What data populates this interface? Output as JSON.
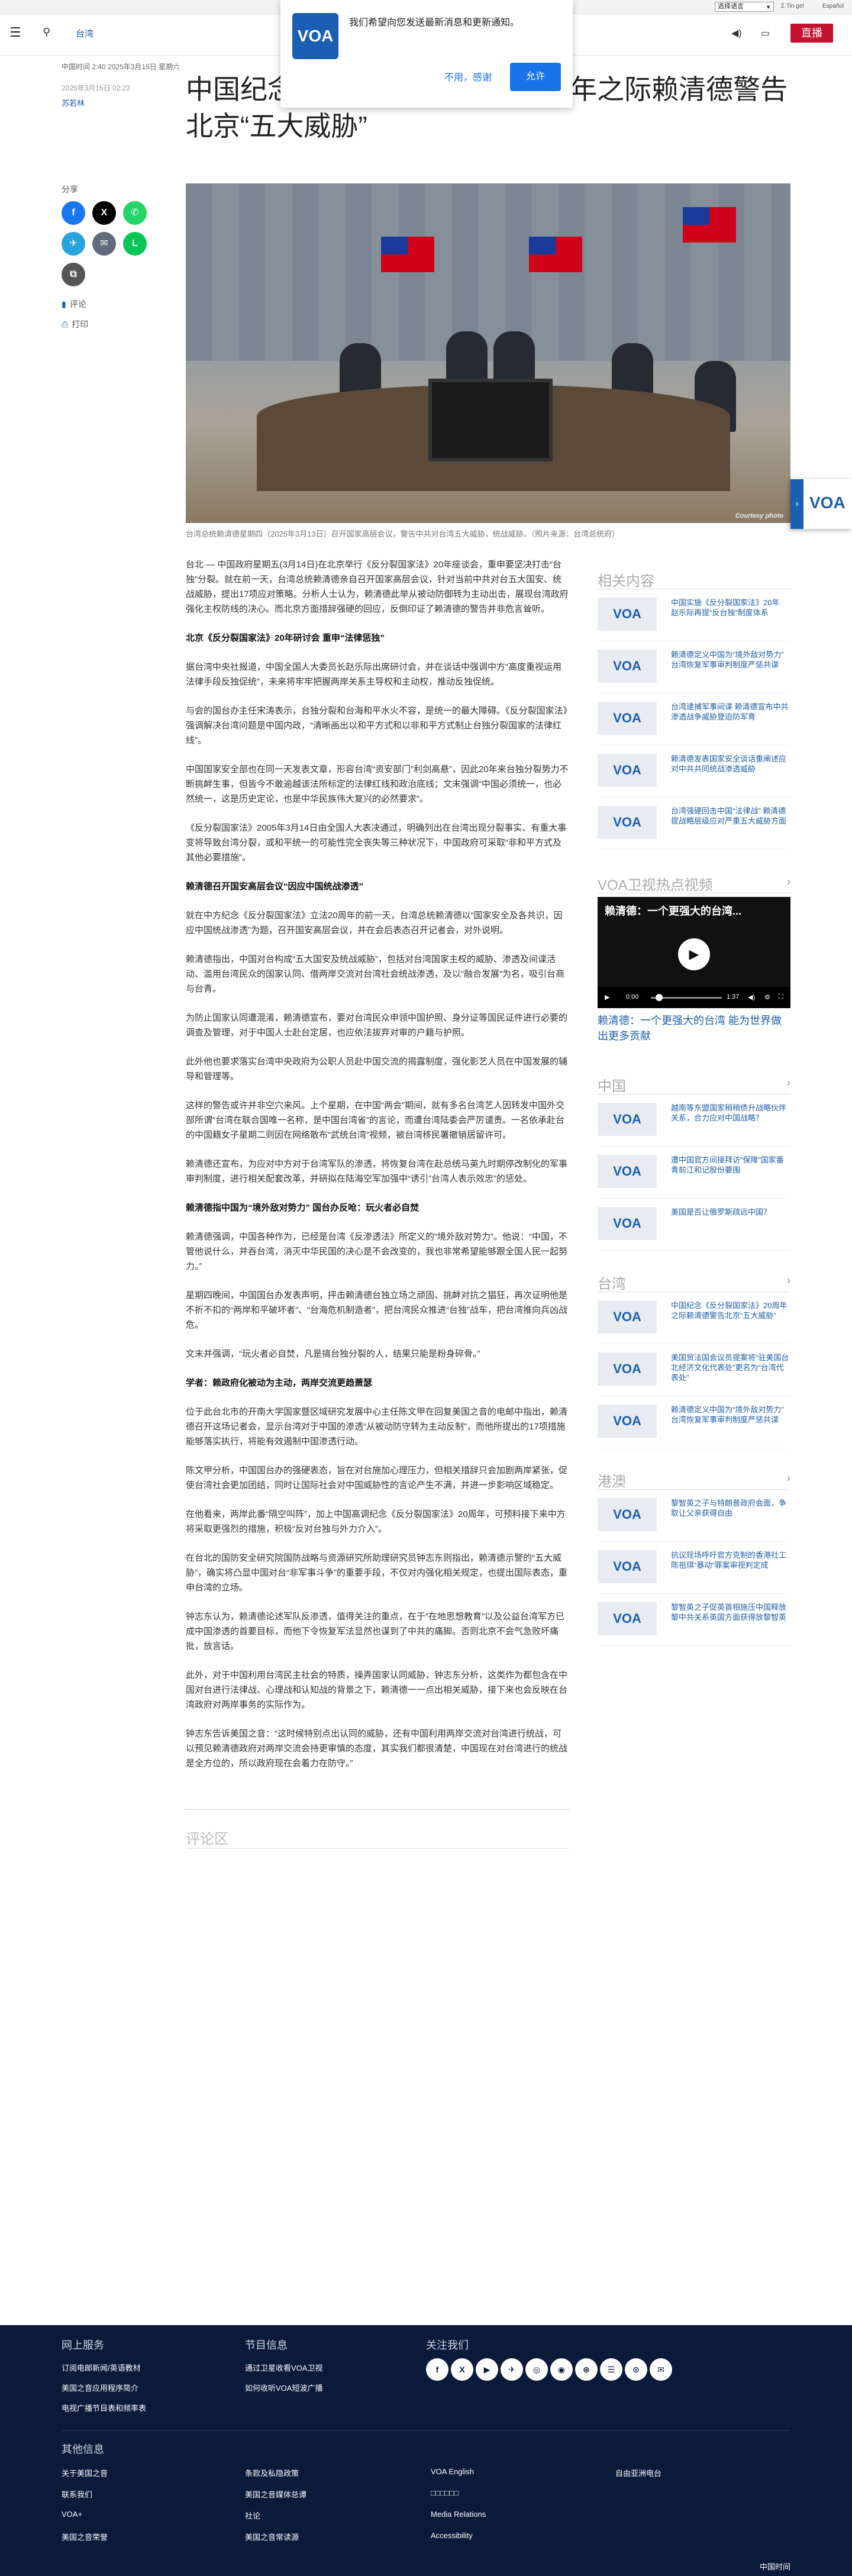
{
  "topbar": {
    "language": "选择语言",
    "links": [
      "Σ Tin gel",
      "Español"
    ]
  },
  "header": {
    "section": "台湾",
    "live_label": "直播"
  },
  "notification": {
    "logo": "VOA",
    "message": "我们希望向您发送最新消息和更新通知。",
    "decline": "不用，感谢",
    "allow": "允许"
  },
  "meta": {
    "time": "中国时间 2:40 2025年3月15日 星期六",
    "date": "2025年3月15日 02:22",
    "author": "苏若林"
  },
  "article": {
    "title": "中国纪念《反分裂国家法》20周年之际赖清德警告北京“五大威胁”",
    "caption": "台湾总统赖清德星期四（2025年3月13日）召开国家高层会议，警告中共对台湾五大威胁，统战威胁。（照片来源：台湾总统府）",
    "photo_credit": "Courtesy photo",
    "body": [
      {
        "type": "p",
        "text": "台北 — 中国政府星期五(3月14日)在北京举行《反分裂国家法》20年座谈会，重申要坚决打击“台独”分裂。就在前一天，台湾总统赖清德亲自召开国家高层会议，针对当前中共对台五大国安、统战威胁，提出17项应对策略。分析人士认为，赖清德此举从被动防御转为主动出击，展现台湾政府强化主权防线的决心。而北京方面措辞强硬的回应，反倒印证了赖清德的警告并非危言耸听。"
      },
      {
        "type": "h",
        "text": "北京《反分裂国家法》20年研讨会 重申“法律惩独”"
      },
      {
        "type": "p",
        "text": "据台湾中央社报道，中国全国人大委员长赵乐际出席研讨会，并在谈话中强调中方“高度重视运用法律手段反独促统”，未来将牢牢把握两岸关系主导权和主动权，推动反独促统。"
      },
      {
        "type": "p",
        "text": "与会的国台办主任宋涛表示，台独分裂和台海和平水火不容，是统一的最大障碍。《反分裂国家法》强调解决台湾问题是中国内政，“清晰画出以和平方式和以非和平方式制止台独分裂国家的法律红线”。"
      },
      {
        "type": "p",
        "text": "中国国家安全部也在同一天发表文章，形容台湾“资安部门”利剑高悬”，因此20年来台独分裂势力不断挑衅生事，但皆今不敢逾越该法所标定的法律红线和政治底线；文末强调“中国必须统一，也必然统一，这是历史定论，也是中华民族伟大复兴的必然要求”。"
      },
      {
        "type": "p",
        "text": "《反分裂国家法》2005年3月14日由全国人大表决通过，明确列出在台湾出现分裂事实、有重大事变将导致台湾分裂，或和平统一的可能性完全丧失等三种状况下，中国政府可采取“非和平方式及其他必要措施”。"
      },
      {
        "type": "h",
        "text": "赖清德召开国安高层会议“因应中国统战渗透”"
      },
      {
        "type": "p",
        "text": "就在中方纪念《反分裂国家法》立法20周年的前一天，台湾总统赖清德以“国家安全及各共识，因应中国统战渗透”为题，召开国安高层会议，并在会后表态召开记者会，对外说明。"
      },
      {
        "type": "p",
        "text": "赖清德指出，中国对台构成“五大国安及统战威胁”，包括对台湾国家主权的威胁、渗透及间谍活动、滥用台湾民众的国家认同、借两岸交流对台湾社会统战渗透，及以“融合发展”为名，吸引台商与台青。"
      },
      {
        "type": "p",
        "text": "为防止国家认同遭混淆，赖清德宣布，要对台湾民众申领中国护照、身分证等国民证件进行必要的调查及管理，对于中国人士赴台定居，也应依法拔弃对审的户籍与护照。"
      },
      {
        "type": "p",
        "text": "此外他也要求落实台湾中央政府为公职人员赴中国交流的揭露制度，强化影艺人员在中国发展的辅导和管理等。"
      },
      {
        "type": "p",
        "text": "这样的警告或许并非空穴来风。上个星期，在中国“两会”期间，就有多名台湾艺人因转发中国外交部所谓“台湾在联合国唯一名称，是中国台湾省”的言论，而遭台湾陆委会严厉谴责。一名依承赴台的中国籍女子星期二则因在网络散布“武统台湾”视频，被台湾移民署撤销居留许可。"
      },
      {
        "type": "p",
        "text": "赖清德还宣布，为应对中方对于台湾军队的渗透，将恢复台湾在赴总统马英九时期停改制化的军事审判制度，进行相关配套改革，并研拟在陆海空军加强中“诱引”台湾人表示效忠”的惩处。"
      },
      {
        "type": "h",
        "text": "赖清德指中国为“境外敌对势力” 国台办反呛：玩火者必自焚"
      },
      {
        "type": "p",
        "text": "赖清德强调，中国各种作为，已经是台湾《反渗透法》所定义的“境外敌对势力”。他说：“中国，不管他说什么，并吞台湾，消灭中华民国的决心是不会改变的，我也非常希望能够跟全国人民一起努力。”"
      },
      {
        "type": "p",
        "text": "星期四晚间，中国国台办发表声明，抨击赖清德台独立场之顽固、挑衅对抗之猖狂，再次证明他是不折不扣的“两岸和平破坏者”、“台海危机制造者”，把台湾民众推进“台独”战车，把台湾推向兵凶战危。"
      },
      {
        "type": "p",
        "text": "文末并强调，“玩火者必自焚，凡是搞台独分裂的人，结果只能是粉身碎骨。”"
      },
      {
        "type": "h",
        "text": "学者：赖政府化被动为主动，两岸交流更趋萧瑟"
      },
      {
        "type": "p",
        "text": "位于此台北市的开南大学国家暨区域研究发展中心主任陈文甲在回复美国之音的电邮中指出，赖清德召开这场记者会，显示台湾对于中国的渗透“从被动防守转为主动反制”，而他所提出的17项措施能够落实执行，将能有效遏制中国渗透行动。"
      },
      {
        "type": "p",
        "text": "陈文甲分析，中国国台办的强硬表态，旨在对台施加心理压力，但相关措辞只会加剧两岸紧张，促使台湾社会更加团结，同时让国际社会对中国威胁性的言论产生不满，并进一步影响区域稳定。"
      },
      {
        "type": "p",
        "text": "在他看来，两岸此番“隔空叫阵”，加上中国高调纪念《反分裂国家法》20周年，可预料接下来中方将采取更强烈的措施，积极“反对台独与外力介入”。"
      },
      {
        "type": "p",
        "text": "在台北的国防安全研究院国防战略与资源研究所助理研究员钟志东则指出，赖清德示警的“五大威胁”，确实将凸显中国对台“非军事斗争”的重要手段，不仅对内强化相关规定，也提出国际表态，重申台湾的立场。"
      },
      {
        "type": "p",
        "text": "钟志东认为，赖清德论述军队反渗透，值得关注的重点，在于“在地思想教育”以及公益台湾军方已成中国渗透的首要目标，而他下令恢复军法显然也谋到了中共的痛脚。否则北京不会气急败坏痛批，放言话。"
      },
      {
        "type": "p",
        "text": "此外，对于中国利用台湾民主社会的特质，操弄国家认同威胁，钟志东分析，这类作为都包含在中国对台进行法律战、心理战和认知战的背景之下，赖清德一一点出相关威胁，接下来也会反映在台湾政府对两岸事务的实际作为。"
      },
      {
        "type": "p",
        "text": "钟志东告诉美国之音：“这时候特别点出认同的威胁，还有中国利用两岸交流对台湾进行统战，可以预见赖清德政府对两岸交流会持更审慎的态度，其实我们都很清楚，中国现在对台湾进行的统战是全方位的，所以政府现在会着力在防守。”"
      }
    ],
    "comments_label": "评论区"
  },
  "sidebar": {
    "share_label": "分享",
    "comment_label": "评论",
    "print_label": "打印",
    "related": {
      "title": "相关内容",
      "items": [
        "中国实施《反分裂国家法》20年 赵乐际再提“反台独”制度体系",
        "赖清德定义中国为“境外敌对势力” 台湾恢复军事审判制度严惩共谍",
        "台湾逮捕军事间谍 赖清德宣布中共渗透战争威胁登迫防军育",
        "赖清德发表国家安全谈话重阐述应对中共共同统战渗透威胁",
        "台湾强硬回击中国“法律战” 赖清德提战略层级应对严重五大威胁方面"
      ]
    },
    "video": {
      "title": "VOA卫视热点视频",
      "clip_title": "赖清德：一个更强大的台湾...",
      "time_current": "0:00",
      "time_total": "1:37",
      "caption": "赖清德：一个更强大的台湾 能为世界做出更多贡献"
    },
    "china": {
      "title": "中国",
      "items": [
        "越南等东盟国家稍稍债升战略伙伴关系，合力应对中国战略？",
        "遭中国官方间接拜访“保障”国家番青前江和记股份要围",
        "美国是否让俄罗斯疏远中国？"
      ]
    },
    "taiwan": {
      "title": "台湾",
      "items": [
        "中国纪念《反分裂国家法》20周年之际赖清德警告北京“五大威胁”",
        "美国贸法国会议员提案将“驻美国台北经济文化代表处”更名为“台湾代表处”",
        "赖清德定义中国为“境外敌对势力” 台湾恢复军事审判制度严惩共谍"
      ]
    },
    "hongkong": {
      "title": "港澳",
      "items": [
        "黎智英之子与特朗普政府会面，争取让父亲获得自由",
        "抗议现场呼吁官方克制的香港社工陈祖琪“暴动”罪案审视判定成",
        "黎智英之子促英首相施压中国释放黎中共关系英国方面获得放黎智英"
      ]
    }
  },
  "footer": {
    "col1_title": "网上服务",
    "col1_links": [
      "订阅电邮新闻/英语教材",
      "美国之音应用程序简介",
      "电视广播节目表和频率表"
    ],
    "col2_title": "节目信息",
    "col2_links": [
      "通过卫星收看VOA卫视",
      "如何收听VOA短波广播"
    ],
    "col3_title": "关注我们",
    "socials": [
      "f",
      "X",
      "▶",
      "✈",
      "◎",
      "◉",
      "⊛",
      "☰",
      "⊙",
      "✉"
    ],
    "other_title": "其他信息",
    "other_col1": [
      "关于美国之音",
      "联系我们",
      "VOA+",
      "美国之音荣誉"
    ],
    "other_col2": [
      "条款及私隐政策",
      "美国之音媒体总谭",
      "社论",
      "美国之音常读源"
    ],
    "other_col3": [
      "VOA English",
      "□□□□□□",
      "Media Relations",
      "Accessibility"
    ],
    "other_col4": [
      "自由亚洲电台"
    ],
    "copyright": "中国时间"
  }
}
